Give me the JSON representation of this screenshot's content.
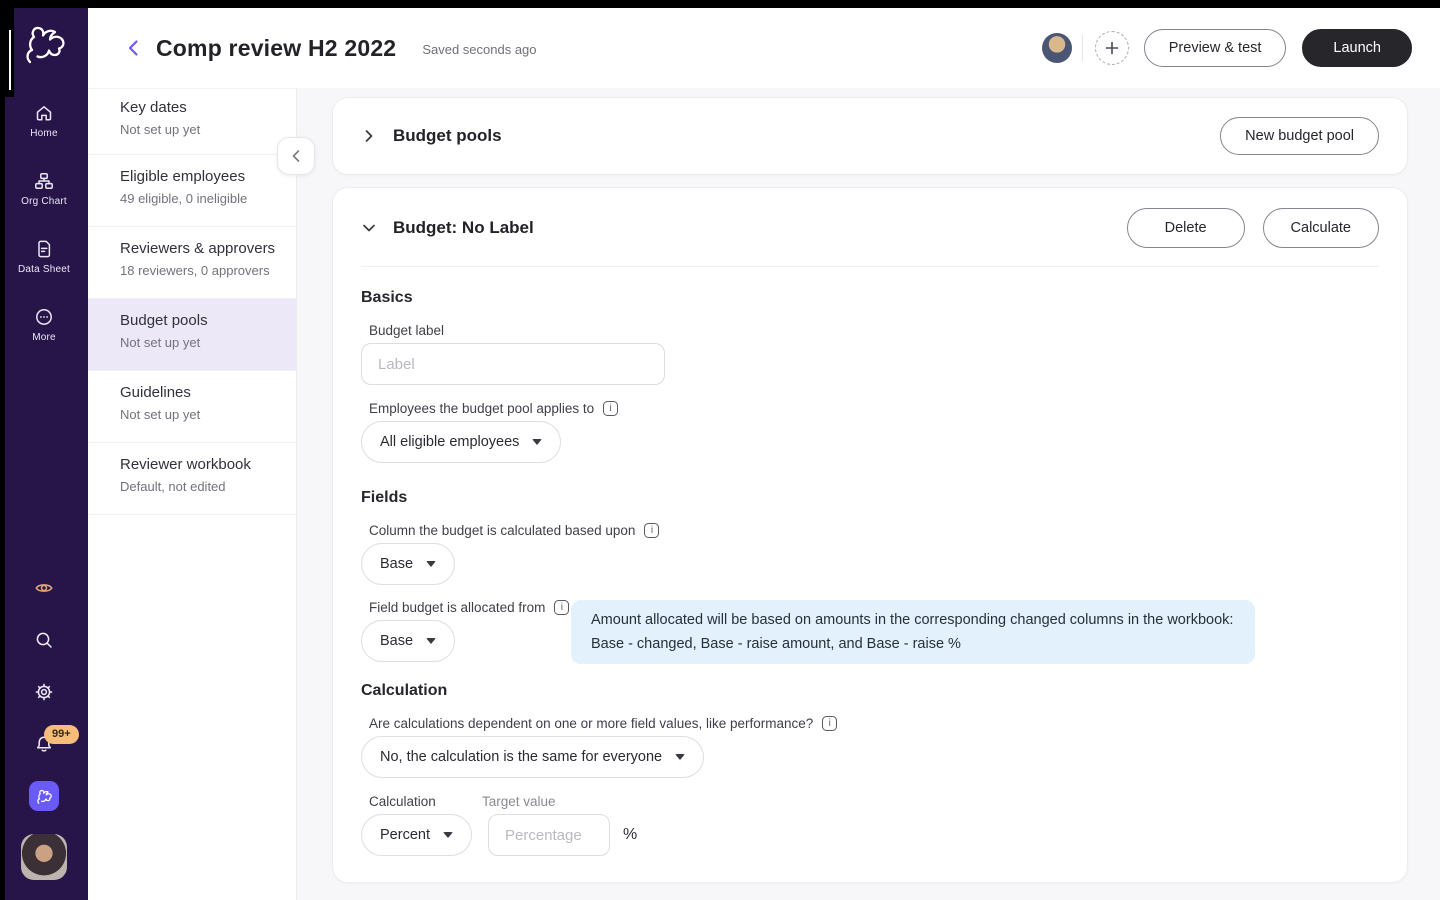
{
  "brand": {
    "accent_purple": "#6a5af7",
    "rail_bg": "#27154a",
    "selected_item_bg": "#ece8f7",
    "note_bg": "#e2f1fb",
    "launch_bg": "#26262b",
    "badge_bg": "#f6bc79",
    "eye_icon_color": "#e9ac74"
  },
  "left_nav": {
    "logo_icon": "pave-rabbit-logo",
    "items": [
      {
        "icon": "home-icon",
        "label": "Home"
      },
      {
        "icon": "org-chart-icon",
        "label": "Org Chart"
      },
      {
        "icon": "data-sheet-icon",
        "label": "Data Sheet"
      },
      {
        "icon": "more-icon",
        "label": "More"
      }
    ],
    "bottom_items": [
      {
        "icon": "eye-icon"
      },
      {
        "icon": "search-icon"
      },
      {
        "icon": "settings-gear-icon"
      },
      {
        "icon": "notifications-bell-icon",
        "badge": "99+"
      },
      {
        "icon": "pave-rabbit-tile-icon"
      },
      {
        "icon": "user-avatar"
      }
    ]
  },
  "header": {
    "back_icon": "chevron-left-icon",
    "title": "Comp review H2 2022",
    "saved_status": "Saved seconds ago",
    "add_icon": "plus-icon",
    "preview_button": "Preview & test",
    "launch_button": "Launch"
  },
  "setup_nav": {
    "collapse_icon": "chevron-left-icon",
    "items": [
      {
        "title": "Key dates",
        "subtitle": "Not set up yet",
        "selected": false
      },
      {
        "title": "Eligible employees",
        "subtitle": "49 eligible, 0 ineligible",
        "selected": false
      },
      {
        "title": "Reviewers & approvers",
        "subtitle": "18 reviewers, 0 approvers",
        "selected": false
      },
      {
        "title": "Budget pools",
        "subtitle": "Not set up yet",
        "selected": true
      },
      {
        "title": "Guidelines",
        "subtitle": "Not set up yet",
        "selected": false
      },
      {
        "title": "Reviewer workbook",
        "subtitle": "Default, not edited",
        "selected": false
      }
    ]
  },
  "main": {
    "pools_card": {
      "expand_icon": "chevron-right-icon",
      "title": "Budget pools",
      "new_button": "New budget pool"
    },
    "budget_card": {
      "collapse_icon": "chevron-down-icon",
      "title": "Budget: No Label",
      "delete_button": "Delete",
      "calculate_button": "Calculate",
      "basics": {
        "heading": "Basics",
        "budget_label": {
          "label": "Budget label",
          "placeholder": "Label",
          "value": ""
        },
        "applies_to": {
          "label": "Employees the budget pool applies to",
          "value": "All eligible employees"
        }
      },
      "fields": {
        "heading": "Fields",
        "column_based": {
          "label": "Column the budget is calculated based upon",
          "value": "Base"
        },
        "allocated_from": {
          "label": "Field budget is allocated from",
          "value": "Base"
        },
        "note_line1": "Amount allocated will be based on amounts in the corresponding changed columns in the workbook:",
        "note_line2": "Base - changed, Base - raise amount, and Base - raise %"
      },
      "calculation": {
        "heading": "Calculation",
        "dependent": {
          "label": "Are calculations dependent on one or more field values, like performance?",
          "value": "No, the calculation is the same for everyone"
        },
        "calc_type": {
          "label": "Calculation",
          "value": "Percent"
        },
        "target": {
          "label": "Target value",
          "placeholder": "Percentage",
          "value": "",
          "suffix": "%"
        }
      }
    }
  }
}
